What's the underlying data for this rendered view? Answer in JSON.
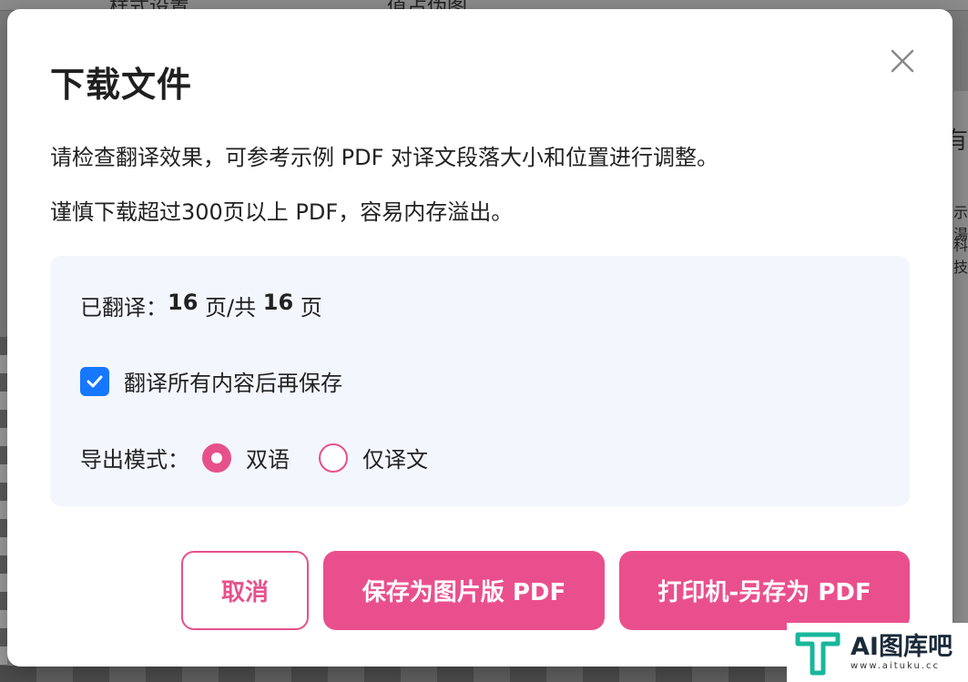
{
  "background": {
    "toolbar_texts": [
      "样式设置",
      "值占伪图"
    ],
    "right_chars": [
      "有",
      "示湯",
      "科技"
    ]
  },
  "dialog": {
    "title": "下载文件",
    "close_icon": "close-icon",
    "description_1": "请检查翻译效果，可参考示例 PDF 对译文段落大小和位置进行调整。",
    "description_2": "谨慎下载超过300页以上 PDF，容易内存溢出。",
    "progress": {
      "label": "已翻译：",
      "done": "16",
      "unit_1": " 页/共 ",
      "total": "16",
      "unit_2": " 页"
    },
    "checkbox": {
      "label": "翻译所有内容后再保存",
      "checked": true
    },
    "export_mode": {
      "label": "导出模式：",
      "options": [
        "双语",
        "仅译文"
      ],
      "selected": "双语"
    },
    "buttons": {
      "cancel": "取消",
      "save_image_pdf": "保存为图片版 PDF",
      "print_pdf": "打印机-另存为 PDF"
    }
  },
  "watermark": {
    "title": "AI图库吧",
    "url": "www.aituku.cc"
  },
  "colors": {
    "accent": "#ea4f8d",
    "checkbox": "#1677ff",
    "panel_bg": "#f4f6fe"
  }
}
